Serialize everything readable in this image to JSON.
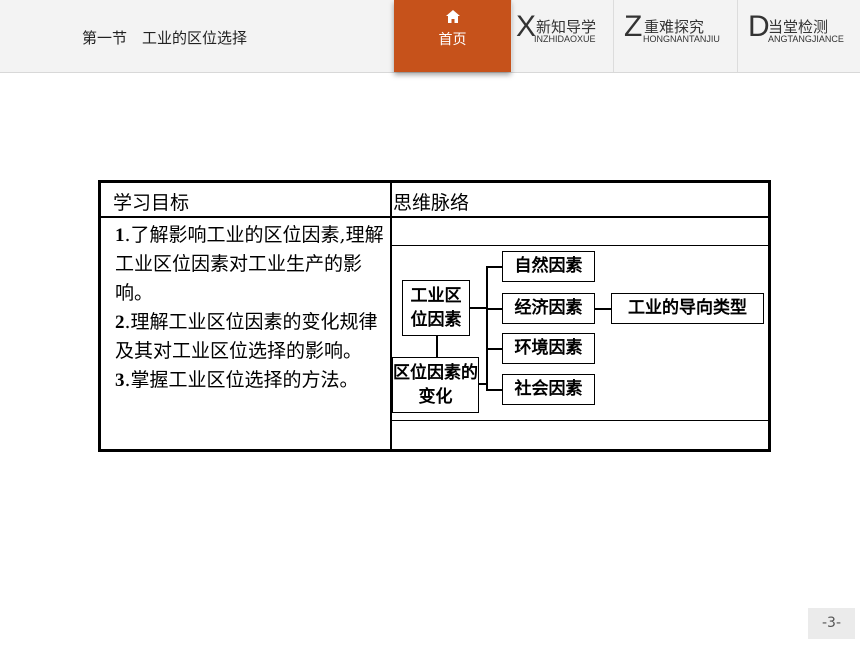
{
  "header": {
    "section_title": "第一节　工业的区位选择",
    "home_label": "首页",
    "tabs": [
      {
        "letter": "X",
        "cn": "新知导学",
        "py": "INZHIDAOXUE"
      },
      {
        "letter": "Z",
        "cn": "重难探究",
        "py": "HONGNANTANJIU"
      },
      {
        "letter": "D",
        "cn": "当堂检测",
        "py": "ANGTANGJIANCE"
      }
    ]
  },
  "table": {
    "col1_header": "学习目标",
    "col2_header": "思维脉络",
    "goals": [
      {
        "num": "1",
        "text": ".了解影响工业的区位因素,理解工业区位因素对工业生产的影响。"
      },
      {
        "num": "2",
        "text": ".理解工业区位因素的变化规律及其对工业区位选择的影响。"
      },
      {
        "num": "3",
        "text": ".掌握工业区位选择的方法。"
      }
    ]
  },
  "mindmap": {
    "root": "工业区位因素",
    "change": "区位因素的变化",
    "factors": [
      "自然因素",
      "经济因素",
      "环境因素",
      "社会因素"
    ],
    "result": "工业的导向类型"
  },
  "footer": {
    "page_number": "-3-"
  }
}
